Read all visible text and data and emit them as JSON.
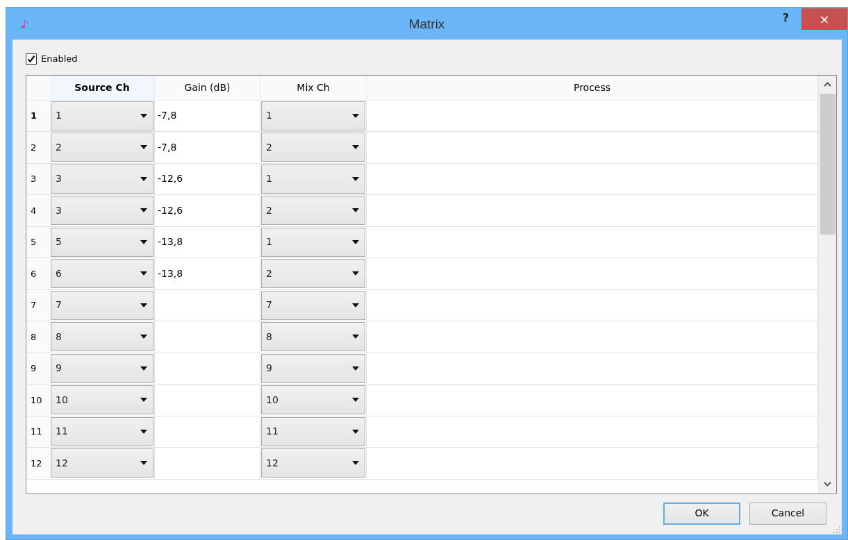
{
  "window": {
    "title": "Matrix",
    "help": "?",
    "close": "×"
  },
  "enabled": {
    "label": "Enabled",
    "checked": true
  },
  "table": {
    "columns": [
      {
        "label": "Source Ch",
        "current": true,
        "kind": "combo"
      },
      {
        "label": "Gain (dB)",
        "current": false,
        "kind": "text"
      },
      {
        "label": "Mix Ch",
        "current": false,
        "kind": "combo"
      },
      {
        "label": "Process",
        "current": false,
        "kind": "text"
      }
    ],
    "rows": [
      {
        "header": "1",
        "current": true,
        "cells": [
          "1",
          "-7,8",
          "1",
          null
        ]
      },
      {
        "header": "2",
        "current": false,
        "cells": [
          "2",
          "-7,8",
          "2",
          null
        ]
      },
      {
        "header": "3",
        "current": false,
        "cells": [
          "3",
          "-12,6",
          "1",
          null
        ]
      },
      {
        "header": "4",
        "current": false,
        "cells": [
          "3",
          "-12,6",
          "2",
          null
        ]
      },
      {
        "header": "5",
        "current": false,
        "cells": [
          "5",
          "-13,8",
          "1",
          null
        ]
      },
      {
        "header": "6",
        "current": false,
        "cells": [
          "6",
          "-13,8",
          "2",
          null
        ]
      },
      {
        "header": "7",
        "current": false,
        "cells": [
          "7",
          null,
          "7",
          null
        ]
      },
      {
        "header": "8",
        "current": false,
        "cells": [
          "8",
          null,
          "8",
          null
        ]
      },
      {
        "header": "9",
        "current": false,
        "cells": [
          "9",
          null,
          "9",
          null
        ]
      },
      {
        "header": "10",
        "current": false,
        "cells": [
          "10",
          null,
          "10",
          null
        ]
      },
      {
        "header": "11",
        "current": false,
        "cells": [
          "11",
          null,
          "11",
          null
        ]
      },
      {
        "header": "12",
        "current": false,
        "cells": [
          "12",
          null,
          "12",
          null
        ]
      }
    ]
  },
  "buttons": [
    {
      "label": "OK",
      "focused": true
    },
    {
      "label": "Cancel",
      "focused": false
    }
  ]
}
